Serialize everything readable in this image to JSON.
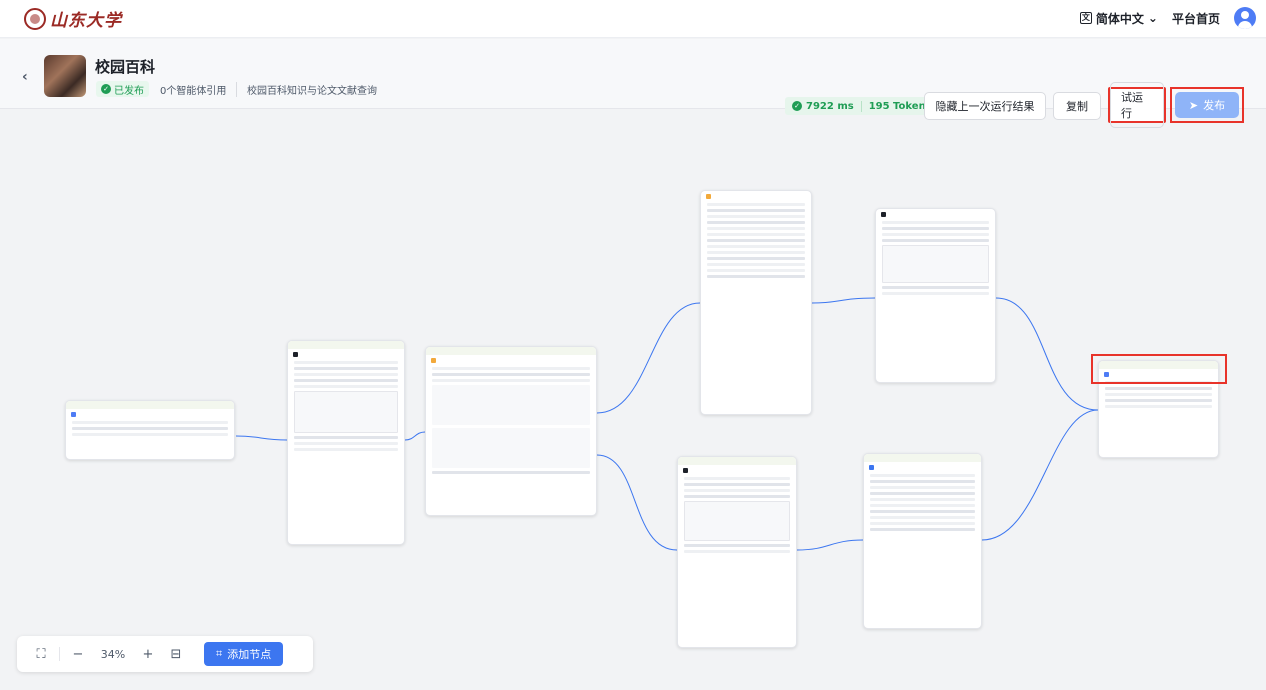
{
  "topbar": {
    "logo_text": "山东大学",
    "language": "简体中文",
    "home": "平台首页"
  },
  "header": {
    "title": "校园百科",
    "status": "已发布",
    "references": "0个智能体引用",
    "description": "校园百科知识与论文文献查询",
    "run_time": "7922 ms",
    "tokens": "195 Tokens",
    "hide_result": "隐藏上一次运行结果",
    "copy": "复制",
    "test_run": "试运行",
    "publish": "发布"
  },
  "zoom": {
    "percent": "34%",
    "add_node": "添加节点"
  },
  "colors": {
    "accent": "#3c76f0",
    "success": "#1f9d55",
    "highlight": "#e8332a",
    "brand": "#9b2a25"
  }
}
